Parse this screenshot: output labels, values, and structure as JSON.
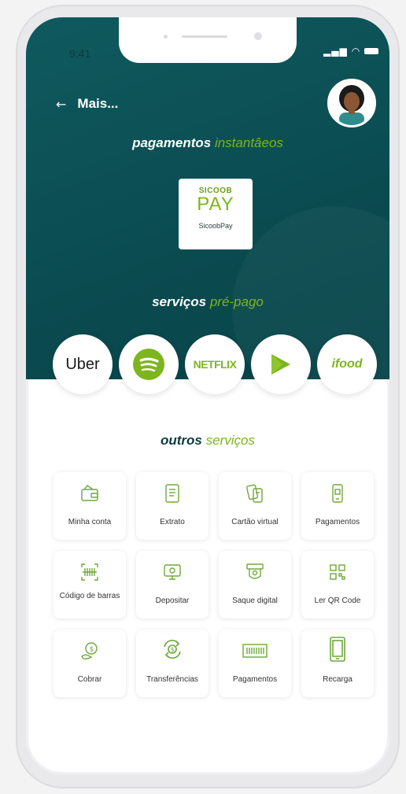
{
  "status": {
    "time": "9:41"
  },
  "header": {
    "back_label": "Mais..."
  },
  "instant_payments": {
    "title_strong": "pagamentos",
    "title_light": "instantâeos"
  },
  "sicoob": {
    "logo_top": "SICOOB",
    "logo_main": "PAY",
    "name": "SicoobPay"
  },
  "prepaid": {
    "title_strong": "serviços",
    "title_light": "pré-pago",
    "items": [
      {
        "label": "Uber",
        "icon": "uber-logo"
      },
      {
        "label": "",
        "icon": "spotify-icon"
      },
      {
        "label": "NETFLIX",
        "icon": "netflix-logo"
      },
      {
        "label": "",
        "icon": "google-play-icon"
      },
      {
        "label": "ifood",
        "icon": "ifood-logo"
      }
    ]
  },
  "other": {
    "title_strong": "outros",
    "title_light": "serviços",
    "tiles": [
      {
        "label": "Minha conta",
        "icon": "wallet-icon"
      },
      {
        "label": "Extrato",
        "icon": "statement-icon"
      },
      {
        "label": "Cartão virtual",
        "icon": "card-icon"
      },
      {
        "label": "Pagamentos",
        "icon": "phone-payment-icon"
      },
      {
        "label": "Código de barras",
        "icon": "barcode-scan-icon"
      },
      {
        "label": "Depositar",
        "icon": "deposit-icon"
      },
      {
        "label": "Saque digital",
        "icon": "atm-icon"
      },
      {
        "label": "Ler QR Code",
        "icon": "qr-code-icon"
      },
      {
        "label": "Cobrar",
        "icon": "charge-icon"
      },
      {
        "label": "Transferências",
        "icon": "transfer-icon"
      },
      {
        "label": "Pagamentos",
        "icon": "barcode-icon"
      },
      {
        "label": "Recarga",
        "icon": "phone-recharge-icon"
      }
    ]
  },
  "colors": {
    "primary": "#0a4b50",
    "accent": "#7db51f",
    "icon": "#6fa83a"
  }
}
